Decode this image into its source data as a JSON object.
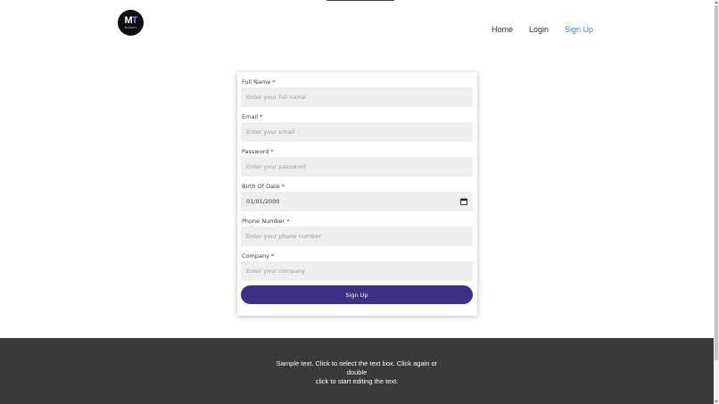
{
  "header": {
    "logo": {
      "mark_left": "M",
      "mark_right": "T",
      "subtitle": "MARKET"
    },
    "nav": [
      {
        "label": "Home",
        "active": false
      },
      {
        "label": "Login",
        "active": false
      },
      {
        "label": "Sign Up",
        "active": true
      }
    ]
  },
  "form": {
    "fields": [
      {
        "label": "Full Name *",
        "placeholder": "Enter your full name",
        "value": ""
      },
      {
        "label": "Email *",
        "placeholder": "Enter your email",
        "value": ""
      },
      {
        "label": "Password *",
        "placeholder": "Enter your password",
        "value": ""
      },
      {
        "label": "Birth Of Date *",
        "placeholder": "",
        "value": "01/01/2000"
      },
      {
        "label": "Phone Number *",
        "placeholder": "Enter your phone number",
        "value": ""
      },
      {
        "label": "Company *",
        "placeholder": "Enter your company",
        "value": ""
      }
    ],
    "submit_label": "Sign Up"
  },
  "footer": {
    "line1": "Sample text. Click to select the text box. Click again or double",
    "line2": "click to start editing the text."
  },
  "colors": {
    "accent": "#3b2f86",
    "nav_active": "#4a78c9",
    "footer_bg": "#3a3a3a",
    "input_bg": "#eeeeee"
  },
  "icons": {
    "calendar": "calendar-icon"
  }
}
